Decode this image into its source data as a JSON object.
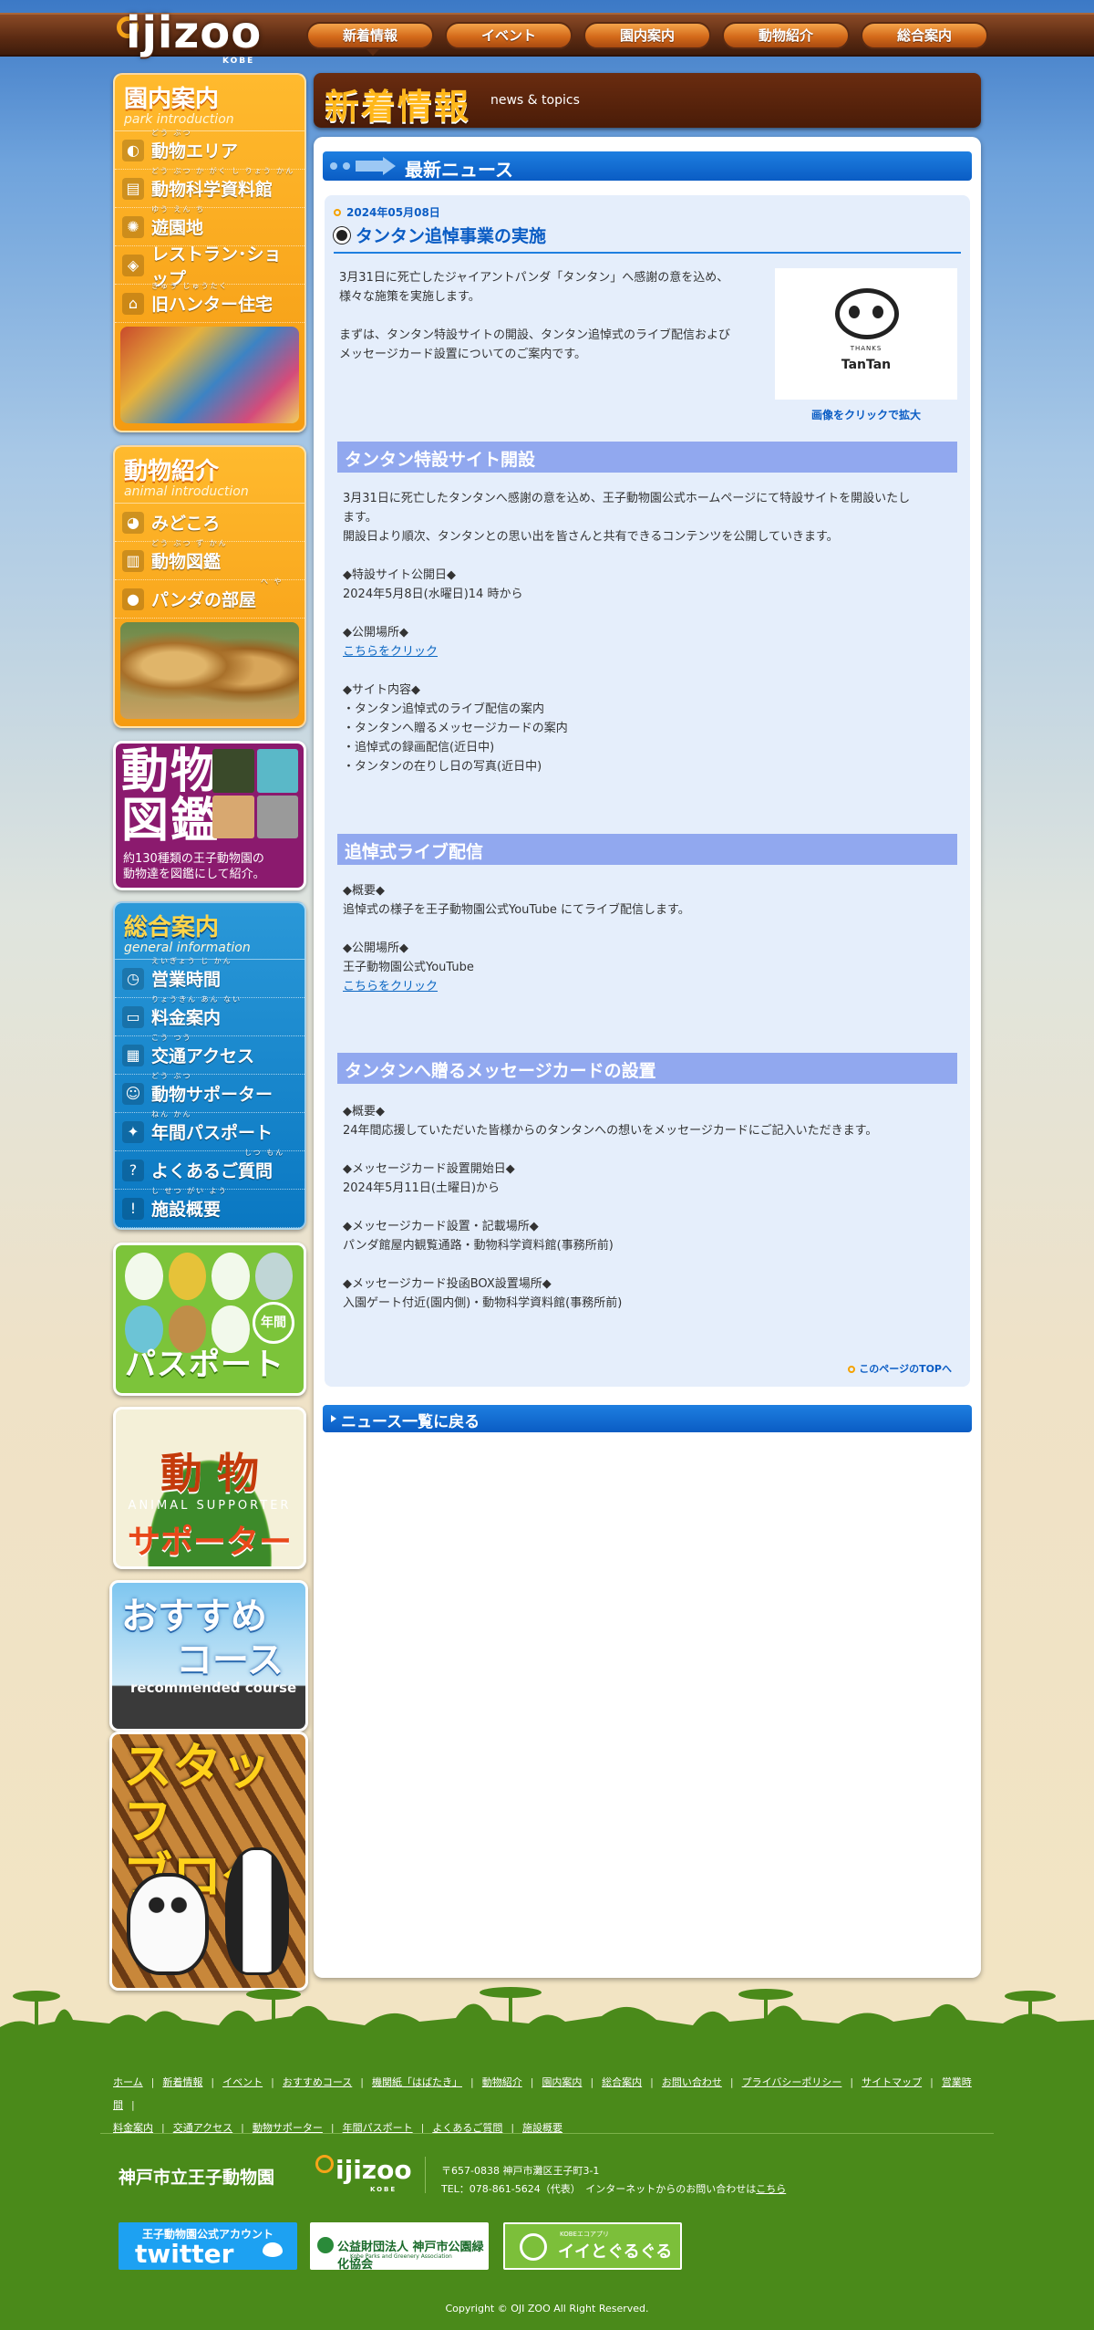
{
  "logo": {
    "text": "ijizoo",
    "sub": "KOBE"
  },
  "nav": [
    {
      "label": "新着情報",
      "active": true
    },
    {
      "label": "イベント"
    },
    {
      "label": "園内案内"
    },
    {
      "label": "動物紹介"
    },
    {
      "label": "総合案内"
    }
  ],
  "sidebar": {
    "park": {
      "title": "園内案内",
      "subtitle": "park introduction",
      "items": [
        {
          "label": "動物エリア",
          "ruby": "どう ぶつ",
          "icon": "elephant-icon"
        },
        {
          "label": "動物科学資料館",
          "ruby": "どう ぶつ か がく し りょう かん",
          "icon": "book-icon"
        },
        {
          "label": "遊園地",
          "ruby": "ゆう えん ち",
          "icon": "ride-icon"
        },
        {
          "label": "レストラン･ショップ",
          "ruby": "",
          "icon": "shop-icon"
        },
        {
          "label": "旧ハンター住宅",
          "ruby": "きゅう じゅうたく",
          "icon": "house-icon"
        }
      ]
    },
    "animal": {
      "title": "動物紹介",
      "subtitle": "animal introduction",
      "items": [
        {
          "label": "みどころ",
          "ruby": "",
          "icon": "star-icon"
        },
        {
          "label": "動物図鑑",
          "ruby": "どう ぶつ ず かん",
          "icon": "encyclopedia-icon"
        },
        {
          "label": "パンダの部屋",
          "ruby": "へ や",
          "icon": "panda-icon"
        }
      ]
    },
    "zukan": {
      "title_line1": "動物",
      "title_line2": "図鑑",
      "desc_line1": "約130種類の王子動物園の",
      "desc_line2": "動物達を図鑑にして紹介。"
    },
    "info": {
      "title": "総合案内",
      "subtitle": "general information",
      "items": [
        {
          "label": "営業時間",
          "ruby": "えいぎょう じ かん",
          "icon": "clock-icon"
        },
        {
          "label": "料金案内",
          "ruby": "りょうきん あん ない",
          "icon": "ticket-icon"
        },
        {
          "label": "交通アクセス",
          "ruby": "こう つう",
          "icon": "map-icon"
        },
        {
          "label": "動物サポーター",
          "ruby": "どう ぶつ",
          "icon": "supporter-icon"
        },
        {
          "label": "年間パスポート",
          "ruby": "ねん かん",
          "icon": "passport-icon"
        },
        {
          "label": "よくあるご質問",
          "ruby": "しつ もん",
          "icon": "question-icon"
        },
        {
          "label": "施設概要",
          "ruby": "し せつ がい よう",
          "icon": "info-icon"
        }
      ]
    },
    "passport": {
      "title": "パスポート",
      "badge": "年間"
    },
    "supporter": {
      "line1": "動 物",
      "line2": "ANIMAL SUPPORTER",
      "line3": "サポーター"
    },
    "course": {
      "line1": "おすすめ",
      "line2": "コース",
      "line3": "recommended course"
    },
    "blog": {
      "line1": "スタッフ",
      "line2": "ブログ"
    }
  },
  "header": {
    "title": "新着情報",
    "subtitle": "news & topics"
  },
  "news": {
    "section_title": "最新ニュース",
    "date": "2024年05月08日",
    "title": "タンタン追悼事業の実施",
    "intro_1": "3月31日に死亡したジャイアントパンダ「タンタン」へ感謝の意を込め、",
    "intro_2": "様々な施策を実施します。",
    "intro_3": "まずは、タンタン特設サイトの開設、タンタン追悼式のライブ配信および",
    "intro_4": "メッセージカード設置についてのご案内です。",
    "thumb_small": "THANKS",
    "thumb_big": "TanTan",
    "enlarge": "画像をクリックで拡大",
    "s1_title": "タンタン特設サイト開設",
    "s1_p1": "3月31日に死亡したタンタンへ感謝の意を込め、王子動物園公式ホームページにて特設サイトを開設いたし",
    "s1_p2": "ます。",
    "s1_p3": "開設日より順次、タンタンとの思い出を皆さんと共有できるコンテンツを公開していきます。",
    "s1_h1": "◆特設サイト公開日◆",
    "s1_v1": "2024年5月8日(水曜日)14 時から",
    "s1_h2": "◆公開場所◆",
    "s1_link": "こちらをクリック",
    "s1_h3": "◆サイト内容◆",
    "s1_l1": "・タンタン追悼式のライブ配信の案内",
    "s1_l2": "・タンタンへ贈るメッセージカードの案内",
    "s1_l3": "・追悼式の録画配信(近日中)",
    "s1_l4": "・タンタンの在りし日の写真(近日中)",
    "s2_title": "追悼式ライブ配信",
    "s2_h1": "◆概要◆",
    "s2_v1": "追悼式の様子を王子動物園公式YouTube にてライブ配信します。",
    "s2_h2": "◆公開場所◆",
    "s2_v2": "王子動物園公式YouTube",
    "s2_link": "こちらをクリック",
    "s3_title": "タンタンへ贈るメッセージカードの設置",
    "s3_h1": "◆概要◆",
    "s3_v1": "24年間応援していただいた皆様からのタンタンへの想いをメッセージカードにご記入いただきます。",
    "s3_h2": "◆メッセージカード設置開始日◆",
    "s3_v2": "2024年5月11日(土曜日)から",
    "s3_h3": "◆メッセージカード設置・記載場所◆",
    "s3_v3": "パンダ館屋内観覧通路・動物科学資料館(事務所前)",
    "s3_h4": "◆メッセージカード投函BOX設置場所◆",
    "s3_v4": "入園ゲート付近(園内側)・動物科学資料館(事務所前)",
    "page_top": "このページのTOPへ",
    "back": "ニュース一覧に戻る"
  },
  "footer": {
    "links_row1": [
      "ホーム",
      "新着情報",
      "イベント",
      "おすすめコース",
      "機関紙「はばたき」",
      "動物紹介",
      "園内案内",
      "総合案内",
      "お問い合わせ",
      "プライバシーポリシー",
      "サイトマップ",
      "営業時間"
    ],
    "links_row2": [
      "料金案内",
      "交通アクセス",
      "動物サポーター",
      "年間パスポート",
      "よくあるご質問",
      "施設概要"
    ],
    "zoo_name": "神戸市立王子動物園",
    "logo": "ijizoo",
    "logo_sub": "KOBE",
    "addr": "〒657-0838 神戸市灘区王子町3-1",
    "tel": "TEL：078-861-5624（代表）　インターネットからのお問い合わせは",
    "tel_link": "こちら",
    "twitter_sub": "王子動物園公式アカウント",
    "twitter": "twitter",
    "park": "公益財団法人 神戸市公園緑化協会",
    "park_sub": "Kobe Parks and Greenery Association",
    "app_sub": "KOBEエコアプリ",
    "app": "イイとぐるぐる",
    "copyright": "Copyright © OJI ZOO All Right Reserved."
  }
}
